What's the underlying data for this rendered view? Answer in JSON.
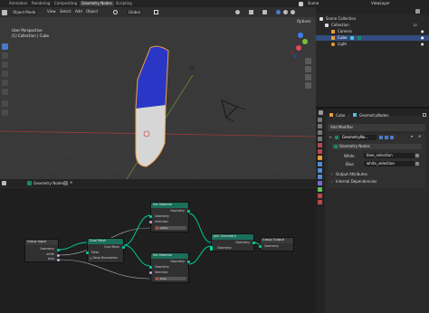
{
  "topbar": {
    "tabs": [
      "Animation",
      "Rendering",
      "Compositing",
      "Geometry Nodes",
      "Scripting"
    ],
    "active_tab": "Geometry Nodes",
    "scene_label": "Scene",
    "viewlayer_label": "ViewLayer"
  },
  "viewport": {
    "mode": "Object Mode",
    "menus": [
      "View",
      "Select",
      "Add",
      "Object"
    ],
    "transform": "Global",
    "options_label": "Options",
    "info_line1": "User Perspective",
    "info_line2": "(1) Collection | Cube",
    "colors": {
      "background": "#393939",
      "mesh_blue": "#2a36c6",
      "mesh_white": "#d6d6d6",
      "selection_outline": "#f0a04b"
    }
  },
  "outliner": {
    "rows": [
      {
        "label": "Scene Collection",
        "level": 0
      },
      {
        "label": "Collection",
        "level": 1
      },
      {
        "label": "Camera",
        "level": 2
      },
      {
        "label": "Cube",
        "level": 2,
        "selected": true
      },
      {
        "label": "Light",
        "level": 2
      }
    ]
  },
  "properties": {
    "breadcrumb_object": "Cube",
    "breadcrumb_modifier": "GeometryNodes",
    "add_modifier": "Add Modifier",
    "modifier_name": "GeometryNo...",
    "node_group": "Geometry Nodes",
    "inputs": [
      {
        "label": "White",
        "value": "blue_selection"
      },
      {
        "label": "Blue",
        "value": "white_selection"
      }
    ],
    "output_attributes": "Output Attributes",
    "internal_dependencies": "Internal Dependencies"
  },
  "node_editor": {
    "tree_name": "Geometry Nodes",
    "nodes": {
      "group_input": {
        "title": "Group Input",
        "sockets": [
          "Geometry",
          "white",
          "blue"
        ]
      },
      "dual_mesh": {
        "title": "Dual Mesh",
        "header_label": "Dual Mesh",
        "inputs": [
          "Mesh",
          "Keep Boundaries"
        ]
      },
      "set_material_1": {
        "title": "Set Material",
        "rows": [
          "Geometry",
          "Selection"
        ],
        "material": "white"
      },
      "set_material_2": {
        "title": "Set Material",
        "rows": [
          "Geometry",
          "Selection"
        ],
        "material": "blue"
      },
      "join_geometry": {
        "title": "Join Geometry",
        "out": "Geometry",
        "in": "Geometry"
      },
      "group_output": {
        "title": "Group Output",
        "rows": [
          "Geometry"
        ]
      }
    },
    "colors": {
      "geometry_socket": "#00d6a3",
      "header_geo": "#1a6e5a",
      "header_group": "#3a3a3a",
      "link": "#00d6a3"
    }
  }
}
